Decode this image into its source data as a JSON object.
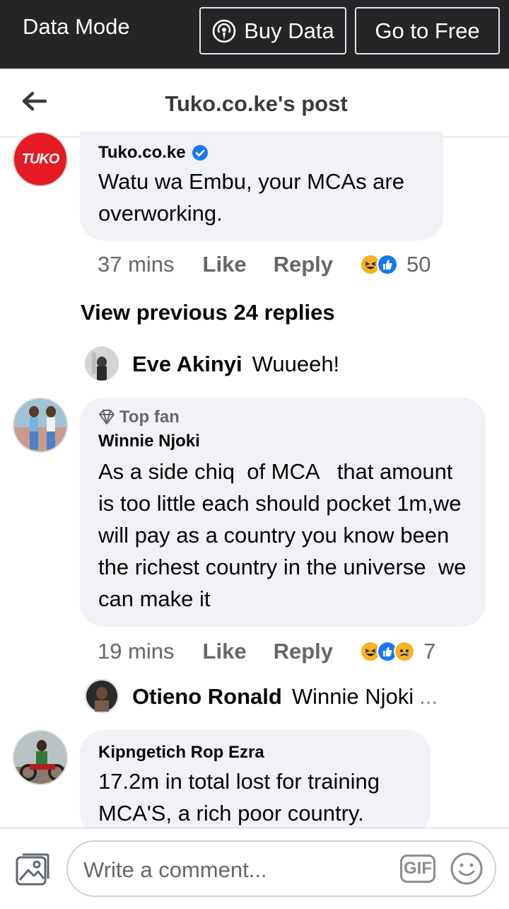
{
  "databar": {
    "mode_label": "Data Mode",
    "buy_label": "Buy Data",
    "free_label": "Go to Free"
  },
  "header": {
    "title": "Tuko.co.ke's post"
  },
  "post_comment": {
    "avatar_text": "TUKO",
    "name": "Tuko.co.ke",
    "text": "Watu wa Embu, your MCAs are overworking.",
    "time": "37 mins",
    "like": "Like",
    "reply": "Reply",
    "reaction_count": "50"
  },
  "view_previous": "View previous 24 replies",
  "reply_eve": {
    "name": "Eve Akinyi",
    "text": "Wuueeh!"
  },
  "comment_winnie": {
    "badge": "Top fan",
    "name": "Winnie Njoki",
    "text": "As a side chiq  of MCA   that amount is too little each should pocket 1m,we will pay as a country you know been the richest country in the universe  we can make it",
    "time": "19 mins",
    "like": "Like",
    "reply": "Reply",
    "reaction_count": "7"
  },
  "reply_otieno": {
    "name": "Otieno Ronald",
    "text": "Winnie Njoki",
    "ellipsis": "..."
  },
  "comment_kipngetich": {
    "name": "Kipngetich Rop Ezra",
    "text": "17.2m in total lost for training MCA'S, a rich poor country."
  },
  "composer": {
    "placeholder": "Write a comment...",
    "gif_label": "GIF"
  },
  "colors": {
    "databar_bg": "#242526",
    "bubble_bg": "#f0f2f5",
    "brand_red": "#e41b23",
    "verified_blue": "#1877f2"
  }
}
